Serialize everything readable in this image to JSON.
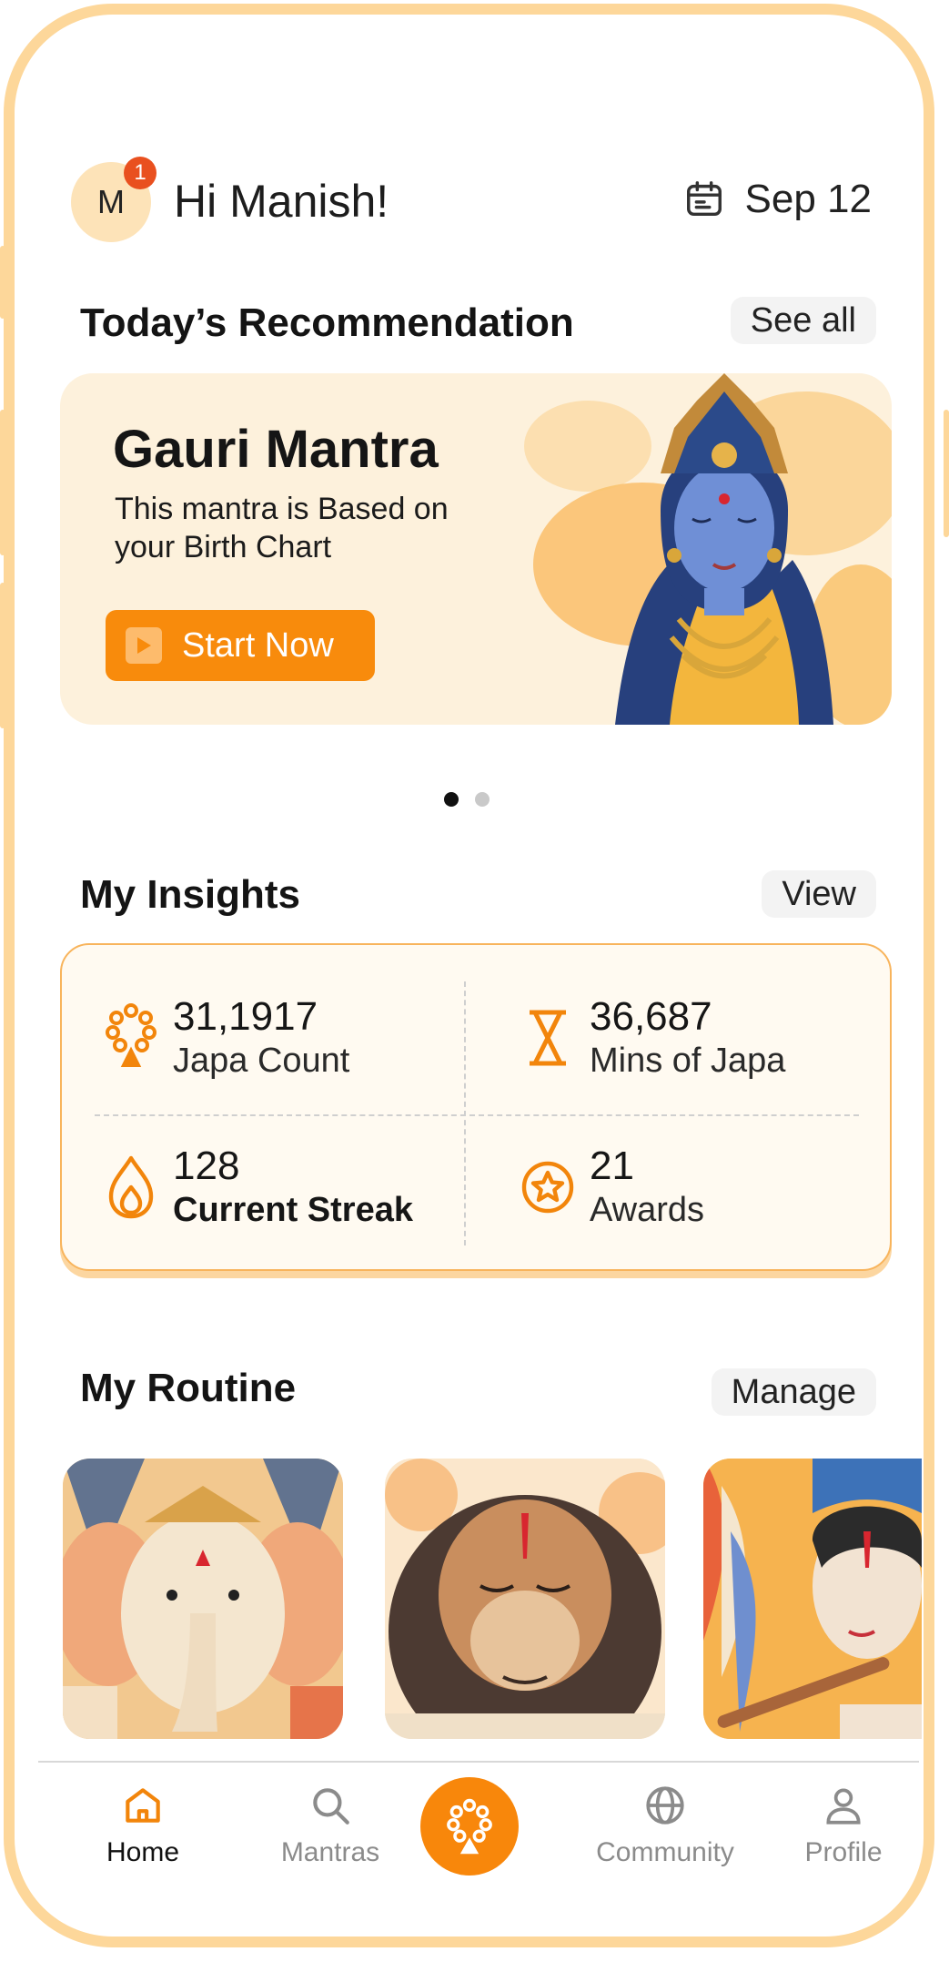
{
  "header": {
    "avatar_initial": "M",
    "notification_count": "1",
    "greeting": "Hi Manish!",
    "date": "Sep 12"
  },
  "recommendation": {
    "section_title": "Today’s Recommendation",
    "see_all_label": "See all",
    "card_title": "Gauri Mantra",
    "card_description": "This mantra is Based on your Birth Chart",
    "start_label": "Start Now",
    "carousel_active_index": 0,
    "carousel_count": 2
  },
  "insights": {
    "section_title": "My Insights",
    "view_label": "View",
    "stats": [
      {
        "value": "31,1917",
        "label": "Japa Count",
        "icon": "mala-beads-icon"
      },
      {
        "value": "36,687",
        "label": "Mins of Japa",
        "icon": "hourglass-icon"
      },
      {
        "value": "128",
        "label": "Current Streak",
        "icon": "flame-icon"
      },
      {
        "value": "21",
        "label": "Awards",
        "icon": "star-badge-icon"
      }
    ]
  },
  "routine": {
    "section_title": "My Routine",
    "manage_label": "Manage",
    "items": [
      {
        "name": "ganesha-illustration"
      },
      {
        "name": "hanuman-illustration"
      },
      {
        "name": "krishna-illustration"
      }
    ]
  },
  "nav": {
    "items": [
      {
        "label": "Home",
        "icon": "home-icon",
        "active": true
      },
      {
        "label": "Mantras",
        "icon": "search-icon",
        "active": false
      },
      {
        "label": "Community",
        "icon": "globe-icon",
        "active": false
      },
      {
        "label": "Profile",
        "icon": "user-icon",
        "active": false
      }
    ],
    "center_icon": "mala-beads-icon"
  },
  "colors": {
    "accent": "#f88b0c",
    "frame": "#fdd79a",
    "badge": "#e9501f",
    "card_bg": "#fdf1dc"
  }
}
